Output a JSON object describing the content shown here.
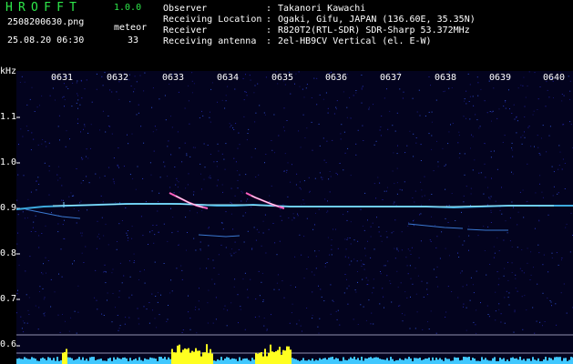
{
  "app": {
    "title": "HROFFT",
    "version": "1.0.0"
  },
  "file": {
    "name": "2508200630.png",
    "datetime": "25.08.20 06:30"
  },
  "detection": {
    "label": "meteor",
    "count": "33"
  },
  "info": [
    {
      "label": "Observer",
      "value": "Takanori Kawachi"
    },
    {
      "label": "Receiving Location",
      "value": "Ogaki, Gifu, JAPAN (136.60E, 35.35N)"
    },
    {
      "label": "Receiver",
      "value": "R820T2(RTL-SDR) SDR-Sharp 53.372MHz"
    },
    {
      "label": "Receiving antenna",
      "value": "2el-HB9CV Vertical (el. E-W)"
    }
  ],
  "colon": ":",
  "axis": {
    "unit": "kHz",
    "y_ticks": [
      "1.1",
      "1.0",
      "0.9",
      "0.8",
      "0.7",
      "0.6"
    ],
    "x_ticks": [
      "0631",
      "0632",
      "0633",
      "0634",
      "0635",
      "0636",
      "0637",
      "0638",
      "0639",
      "0640"
    ]
  },
  "colors": {
    "background": "#000000",
    "plot_background": "#03031e",
    "title_green": "#2ee84a",
    "trace_cyan": "#48c8ff",
    "meteor_pink": "#ff60c0",
    "level_cyan": "#40c8ff",
    "level_yellow": "#ffff20"
  }
}
